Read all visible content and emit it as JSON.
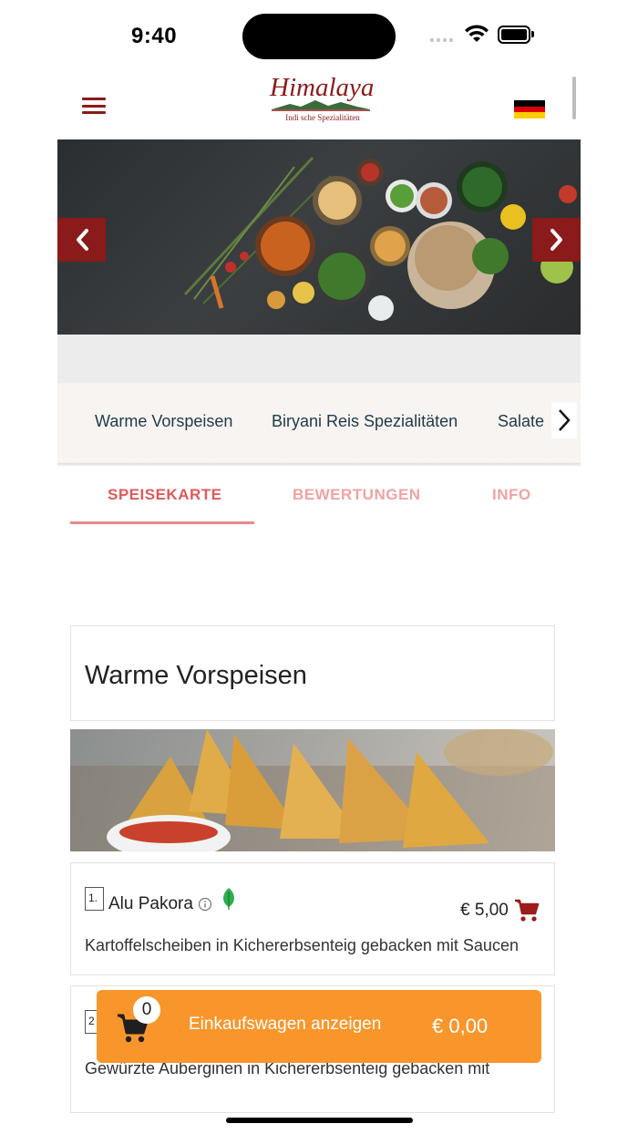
{
  "status_bar": {
    "time": "9:40"
  },
  "header": {
    "logo_title": "Himalaya",
    "logo_subtitle": "Indi sche Spezialitäten",
    "menu_icon": "hamburger-icon",
    "language_flag": "germany-flag-icon",
    "brand_color": "#8b1a1a"
  },
  "banner": {
    "prev_icon": "chevron-left-icon",
    "next_icon": "chevron-right-icon"
  },
  "categories": {
    "items": [
      "Warme Vorspeisen",
      "Biryani Reis Spezialitäten",
      "Salate"
    ],
    "next_icon": "chevron-right-icon"
  },
  "tabs": [
    {
      "label": "SPEISEKARTE",
      "active": true
    },
    {
      "label": "BEWERTUNGEN",
      "active": false
    },
    {
      "label": "INFO",
      "active": false
    }
  ],
  "section": {
    "title": "Warme Vorspeisen"
  },
  "menu_items": [
    {
      "number": "1.",
      "name": "Alu Pakora",
      "price": "€ 5,00",
      "description": "Kartoffelscheiben in Kichererbsenteig gebacken mit Saucen",
      "badges": [
        "info-icon",
        "vegetarian-leaf-icon"
      ]
    },
    {
      "number": "2",
      "name": "",
      "price": "",
      "description": "Gewürzte Auberginen in Kichererbsenteig gebacken mit"
    }
  ],
  "cart_bar": {
    "count": "0",
    "label": "Einkaufswagen anzeigen",
    "total": "€ 0,00",
    "color": "#f8962c"
  }
}
